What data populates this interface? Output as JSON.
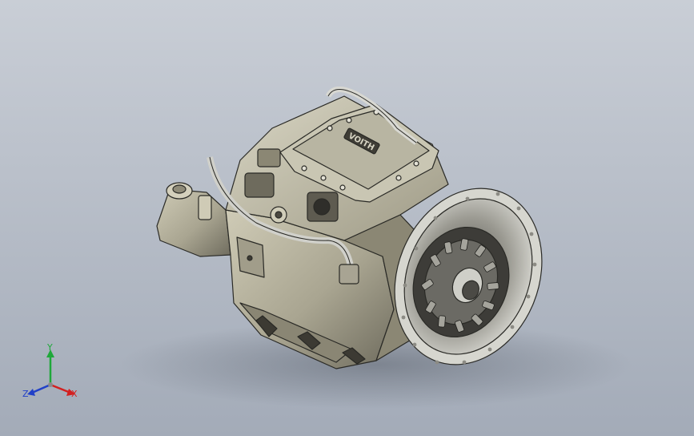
{
  "model": {
    "name": "transmission-assembly",
    "housing_label": "VOITH",
    "colors": {
      "background_top": "#c9ced6",
      "background_bottom": "#a3abb8",
      "housing": "#b2ae9a",
      "housing_dark": "#6e6b5d",
      "edge": "#2a2a26",
      "metal": "#c8c9c7"
    }
  },
  "triad": {
    "x_label": "X",
    "y_label": "Y",
    "z_label": "Z",
    "colors": {
      "x": "#d32020",
      "y": "#1fa83a",
      "z": "#2140c8"
    }
  }
}
